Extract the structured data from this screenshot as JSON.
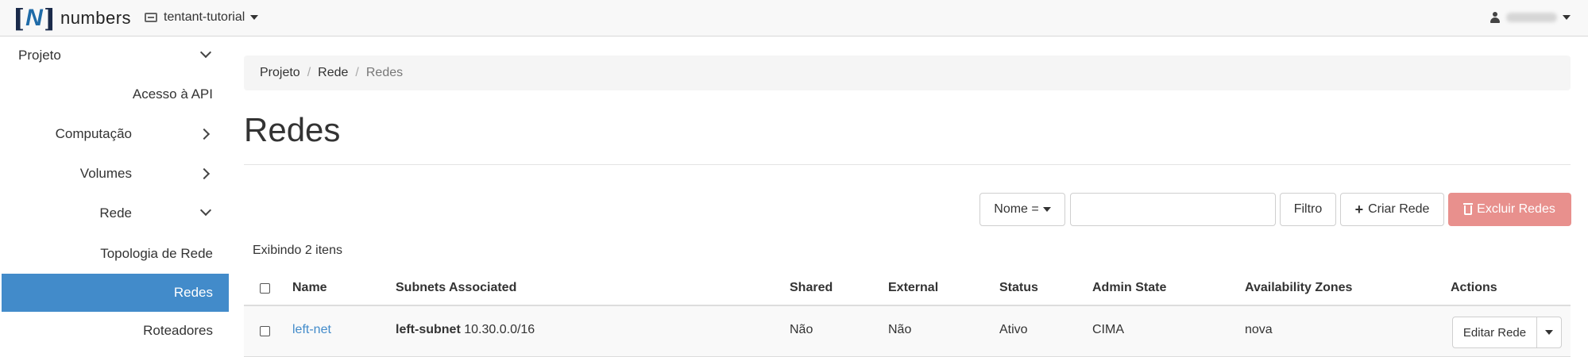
{
  "navbar": {
    "logo": {
      "bracket_open": "[",
      "letter": "N",
      "bracket_close": "]",
      "text": "numbers"
    },
    "project": {
      "icon": "project-icon",
      "label": "tentant-tutorial"
    },
    "user": {
      "icon": "user-icon"
    }
  },
  "sidebar": {
    "items": [
      {
        "label": "Projeto",
        "expander": "chevron-down"
      },
      {
        "label": "Acesso à API"
      },
      {
        "label": "Computação",
        "expander": "chevron-right"
      },
      {
        "label": "Volumes",
        "expander": "chevron-right"
      },
      {
        "label": "Rede",
        "expander": "chevron-down"
      },
      {
        "label": "Topologia de Rede"
      },
      {
        "label": "Redes",
        "active": true
      },
      {
        "label": "Roteadores"
      }
    ],
    "active_color": "#428bca"
  },
  "breadcrumb": [
    "Projeto",
    "Rede",
    "Redes"
  ],
  "page_title": "Redes",
  "toolbar": {
    "filter_select": "Nome =",
    "filter_input_value": "",
    "filter_button": "Filtro",
    "create_button": "Criar Rede",
    "delete_button": "Excluir Redes",
    "delete_color": "#e8908d"
  },
  "table": {
    "count_text": "Exibindo 2 itens",
    "columns": [
      "Name",
      "Subnets Associated",
      "Shared",
      "External",
      "Status",
      "Admin State",
      "Availability Zones",
      "Actions"
    ],
    "rows": [
      {
        "name": "left-net",
        "subnet_name": "left-subnet",
        "subnet_cidr": "10.30.0.0/16",
        "shared": "Não",
        "external": "Não",
        "status": "Ativo",
        "admin_state": "CIMA",
        "availability_zones": "nova",
        "action": "Editar Rede"
      }
    ]
  }
}
